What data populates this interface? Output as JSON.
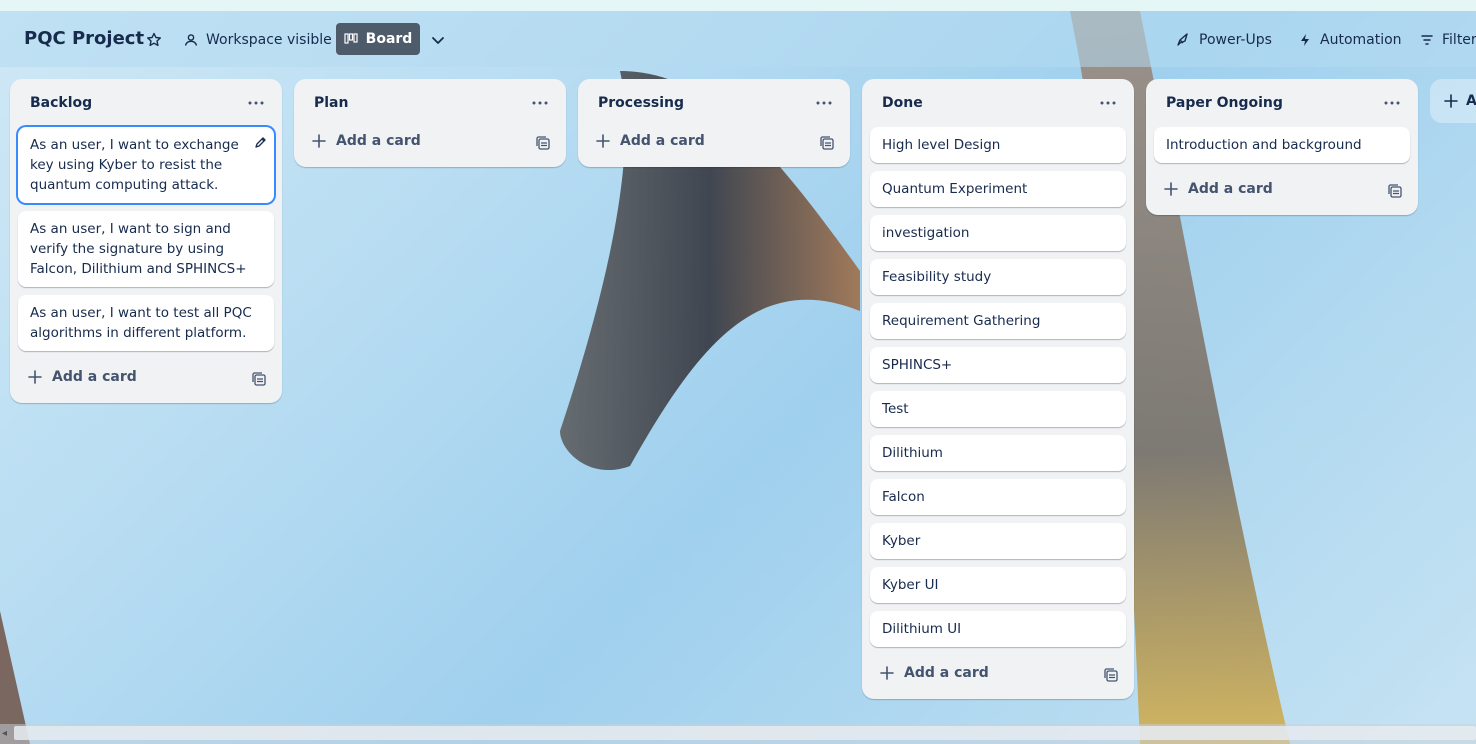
{
  "header": {
    "board_title": "PQC Project",
    "visibility_label": "Workspace visible",
    "view_label": "Board",
    "powerups_label": "Power-Ups",
    "automation_label": "Automation",
    "filters_label": "Filters"
  },
  "icons": {
    "star": "star-icon",
    "visibility": "people-icon",
    "board": "board-icon",
    "dropdown": "chevron-down-icon",
    "powerups": "rocket-icon",
    "automation": "lightning-icon",
    "filters": "filter-icon",
    "list_menu": "more-horizontal-icon",
    "add": "plus-icon",
    "template": "template-icon",
    "edit": "pencil-icon"
  },
  "colors": {
    "accent_selected": "#388bff",
    "view_button_bg": "#4d5b6b"
  },
  "lists": [
    {
      "title": "Backlog",
      "cards": [
        "As an user, I want to exchange key using Kyber to resist the quantum computing attack.",
        "As an user, I want to sign and verify the signature by using Falcon, Dilithium and SPHINCS+",
        "As an user, I want to test all PQC algorithms in different platform."
      ],
      "add_label": "Add a card"
    },
    {
      "title": "Plan",
      "cards": [],
      "add_label": "Add a card"
    },
    {
      "title": "Processing",
      "cards": [],
      "add_label": "Add a card"
    },
    {
      "title": "Done",
      "cards": [
        "High level Design",
        "Quantum Experiment",
        "investigation",
        "Feasibility study",
        "Requirement Gathering",
        "SPHINCS+",
        "Test",
        "Dilithium",
        "Falcon",
        "Kyber",
        "Kyber UI",
        "Dilithium UI"
      ],
      "add_label": "Add a card"
    },
    {
      "title": "Paper Ongoing",
      "cards": [
        "Introduction and background"
      ],
      "add_label": "Add a card"
    }
  ],
  "add_list_label": "A"
}
